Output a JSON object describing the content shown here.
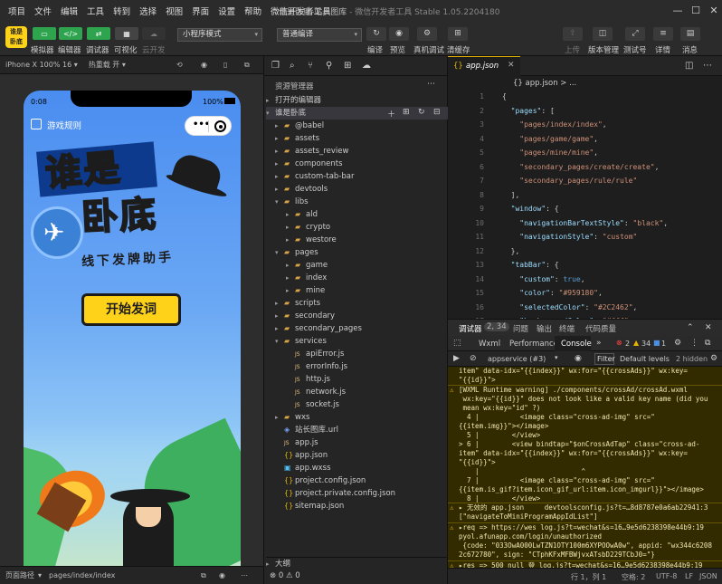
{
  "menu": {
    "items": [
      "项目",
      "文件",
      "编辑",
      "工具",
      "转到",
      "选择",
      "视图",
      "界面",
      "设置",
      "帮助",
      "微信开发者工具"
    ],
    "title": "谁是卧底-站长图库",
    "subtitle": " - 微信开发者工具 Stable 1.05.2204180"
  },
  "toolbar": {
    "simulator": "模拟器",
    "editor": "编辑器",
    "debugger": "调试器",
    "visual": "可视化",
    "cloud": "云开发",
    "mode": "小程序模式",
    "compile": "普通编译",
    "compile_btn": "编译",
    "preview": "预览",
    "realdebug": "真机调试",
    "clearcache": "清缓存",
    "upload": "上传",
    "version": "版本管理",
    "test": "测试号",
    "detail": "详情",
    "message": "消息"
  },
  "simulator": {
    "device": "iPhone X 100% 16",
    "hotreload": "热重载 开",
    "time": "0:08",
    "battery": "100%",
    "nav_title": "游戏规则",
    "logo_line1": "谁是",
    "logo_line2": "卧底",
    "tagline": "线下发牌助手",
    "start": "开始发词",
    "footer_label": "页面路径",
    "footer_path": "pages/index/index"
  },
  "explorer": {
    "header": "资源管理器",
    "open_editors": "打开的编辑器",
    "project": "谁是卧底",
    "items": [
      {
        "name": "@babel",
        "type": "folder",
        "depth": 1,
        "open": false
      },
      {
        "name": "assets",
        "type": "folder",
        "depth": 1,
        "open": false
      },
      {
        "name": "assets_review",
        "type": "folder",
        "depth": 1,
        "open": false
      },
      {
        "name": "components",
        "type": "folder",
        "depth": 1,
        "open": false
      },
      {
        "name": "custom-tab-bar",
        "type": "folder",
        "depth": 1,
        "open": false
      },
      {
        "name": "devtools",
        "type": "folder",
        "depth": 1,
        "open": false
      },
      {
        "name": "libs",
        "type": "folder",
        "depth": 1,
        "open": true
      },
      {
        "name": "ald",
        "type": "folder",
        "depth": 2,
        "open": false
      },
      {
        "name": "crypto",
        "type": "folder",
        "depth": 2,
        "open": false
      },
      {
        "name": "westore",
        "type": "folder",
        "depth": 2,
        "open": false
      },
      {
        "name": "pages",
        "type": "folder",
        "depth": 1,
        "open": true
      },
      {
        "name": "game",
        "type": "folder",
        "depth": 2,
        "open": false
      },
      {
        "name": "index",
        "type": "folder",
        "depth": 2,
        "open": false
      },
      {
        "name": "mine",
        "type": "folder",
        "depth": 2,
        "open": false
      },
      {
        "name": "scripts",
        "type": "folder",
        "depth": 1,
        "open": false
      },
      {
        "name": "secondary",
        "type": "folder",
        "depth": 1,
        "open": false
      },
      {
        "name": "secondary_pages",
        "type": "folder",
        "depth": 1,
        "open": false
      },
      {
        "name": "services",
        "type": "folder",
        "depth": 1,
        "open": true
      },
      {
        "name": "apiError.js",
        "type": "js",
        "depth": 2
      },
      {
        "name": "errorInfo.js",
        "type": "js",
        "depth": 2
      },
      {
        "name": "http.js",
        "type": "js",
        "depth": 2
      },
      {
        "name": "network.js",
        "type": "js",
        "depth": 2
      },
      {
        "name": "socket.js",
        "type": "js",
        "depth": 2
      },
      {
        "name": "wxs",
        "type": "folder",
        "depth": 1,
        "open": false
      },
      {
        "name": "站长图库.url",
        "type": "url",
        "depth": 1
      },
      {
        "name": "app.js",
        "type": "js",
        "depth": 1
      },
      {
        "name": "app.json",
        "type": "json",
        "depth": 1
      },
      {
        "name": "app.wxss",
        "type": "wxss",
        "depth": 1
      },
      {
        "name": "project.config.json",
        "type": "json",
        "depth": 1
      },
      {
        "name": "project.private.config.json",
        "type": "json",
        "depth": 1
      },
      {
        "name": "sitemap.json",
        "type": "json",
        "depth": 1
      }
    ],
    "outline": "大纲",
    "errors": "0",
    "warnings": "0"
  },
  "editor": {
    "tab": "app.json",
    "crumb": "{} app.json > ...",
    "lines": [
      {
        "n": "1",
        "t": "{"
      },
      {
        "n": "2",
        "t": "  \"pages\": ["
      },
      {
        "n": "3",
        "t": "    \"pages/index/index\","
      },
      {
        "n": "4",
        "t": "    \"pages/game/game\","
      },
      {
        "n": "5",
        "t": "    \"pages/mine/mine\","
      },
      {
        "n": "6",
        "t": "    \"secondary_pages/create/create\","
      },
      {
        "n": "7",
        "t": "    \"secondary_pages/rule/rule\""
      },
      {
        "n": "8",
        "t": "  ],"
      },
      {
        "n": "9",
        "t": "  \"window\": {"
      },
      {
        "n": "10",
        "t": "    \"navigationBarTextStyle\": \"black\","
      },
      {
        "n": "11",
        "t": "    \"navigationStyle\": \"custom\""
      },
      {
        "n": "12",
        "t": "  },"
      },
      {
        "n": "13",
        "t": "  \"tabBar\": {"
      },
      {
        "n": "14",
        "t": "    \"custom\": true,"
      },
      {
        "n": "15",
        "t": "    \"color\": \"#959180\","
      },
      {
        "n": "16",
        "t": "    \"selectedColor\": \"#2C2462\","
      },
      {
        "n": "17",
        "t": "    \"backgroundColor\": \"#fff\","
      }
    ]
  },
  "devtools": {
    "tabs": [
      "调试器",
      "问题",
      "输出",
      "终端",
      "代码质量"
    ],
    "badge": "2, 34",
    "panels": [
      "Wxml",
      "Performance",
      "Console"
    ],
    "errors": "2",
    "warns": "34",
    "info": "1",
    "context": "appservice (#3)",
    "filter": "Filter",
    "levels": "Default levels",
    "hidden": "2 hidden",
    "log1": "item\" data-idx=\"{{index}}\" wx:for=\"{{crossAds}}\" wx:key=\n\"{{id}}\">",
    "log2": "[WXML Runtime warning] ./components/crossAd/crossAd.wxml\n wx:key=\"{{id}}\" does not look like a valid key name (did you\n mean wx:key=\"id\" ?)\n  4 |          <image class=\"cross-ad-img\" src=\"\n{{item.img}}\"></image>\n  5 |        </view>\n> 6 |        <view bindtap=\"$onCrossAdTap\" class=\"cross-ad-\nitem\" data-idx=\"{{index}}\" wx:for=\"{{crossAds}}\" wx:key=\n\"{{id}}\">\n    |                         ^\n  7 |          <image class=\"cross-ad-img\" src=\"\n{{item.is_gif?item.icon_gif_url:item.icon_imgurl}}\"></image>\n  8 |        </view>\n  9 |      </view>",
    "log3": "▸ 无效的 app.json     devtoolsconfig.js?t=…8d8787e0a6ab22941:3\n[\"navigateToMiniProgramAppIdList\"]",
    "log4": "▸req => https://wes log.js?t=wechat&s=16…9e5d6238398e44b9:19\npyol.afunapp.com/login/unauthorized\n {code: \"033OwA000LwTZN1OTY100m6XYPOOwA0w\", appid: \"wx344c6208\n2c672780\", sign: \"CTphKFxMFBWjvxATsbD229TCbJ0=\"}",
    "log5": "▸res => 500 null 登 log.js?t=wechat&s=16…9e5d6238398e44b9:19"
  },
  "status": {
    "pos": "行 1，列 1",
    "spaces": "空格: 2",
    "enc": "UTF-8",
    "eol": "LF",
    "lang": "JSON"
  }
}
